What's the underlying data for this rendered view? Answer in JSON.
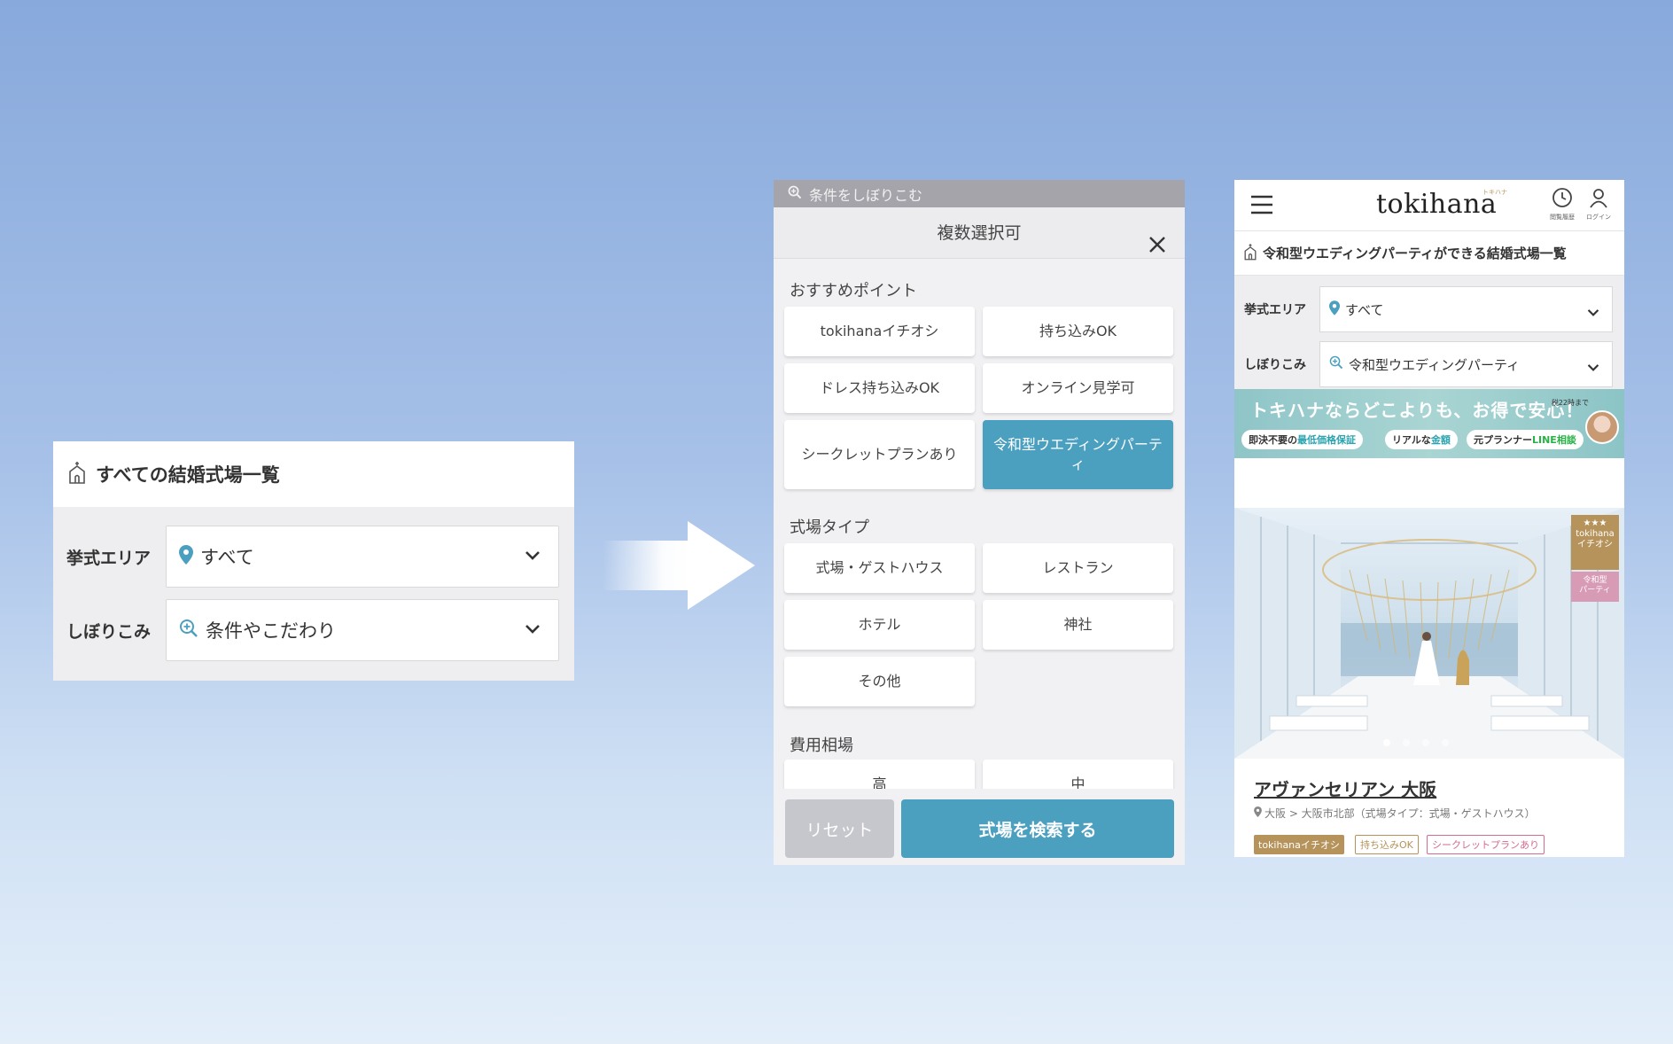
{
  "left_card": {
    "title": "すべての結婚式場一覧",
    "area_label": "挙式エリア",
    "area_value": "すべて",
    "filter_label": "しぼりこみ",
    "filter_value": "条件やこだわり"
  },
  "modal": {
    "search_bar_text": "条件をしぼりこむ",
    "header": "複数選択可",
    "sections": [
      {
        "title": "おすすめポイント"
      },
      {
        "title": "式場タイプ"
      },
      {
        "title": "費用相場"
      }
    ],
    "options": {
      "recommend": [
        "tokihanaイチオシ",
        "持ち込みOK",
        "ドレス持ち込みOK",
        "オンライン見学可",
        "シークレットプランあり",
        "令和型ウエディングパーティ"
      ],
      "type": [
        "式場・ゲストハウス",
        "レストラン",
        "ホテル",
        "神社",
        "その他"
      ],
      "cost": [
        "高",
        "中"
      ]
    },
    "selected_option": "令和型ウエディングパーティ",
    "reset_label": "リセット",
    "search_label": "式場を検索する"
  },
  "phone": {
    "logo": "tokihana",
    "logo_kana": "トキハナ",
    "history_caption": "閲覧履歴",
    "login_caption": "ログイン",
    "page_title": "令和型ウエディングパーティができる結婚式場一覧",
    "area_label": "挙式エリア",
    "area_value": "すべて",
    "filter_label": "しぼりこみ",
    "filter_value": "令和型ウエディングパーティ",
    "banner": {
      "main": "トキハナならどこよりも、お得で安心！",
      "badge": "税22時まで",
      "pills": [
        {
          "prefix": "即決不要の",
          "highlight": "最低価格保証"
        },
        {
          "prefix": "リアルな",
          "highlight": "金額"
        },
        {
          "prefix": "元プランナー",
          "highlight": "LINE相談"
        }
      ]
    },
    "hero_badges": {
      "stars": "★★★",
      "tokihana": "tokihana",
      "ichioshi": "イチオシ",
      "reiwa1": "令和型",
      "reiwa2": "パーティ"
    },
    "venue_name": "アヴァンセリアン 大阪",
    "venue_location": "大阪 > 大阪市北部（式場タイプ：式場・ゲストハウス）",
    "tags": [
      "tokihanaイチオシ",
      "持ち込みOK",
      "シークレットプランあり"
    ]
  },
  "colors": {
    "accent": "#4b9fbf",
    "gold": "#b5935b",
    "pink": "#d46a8e"
  }
}
